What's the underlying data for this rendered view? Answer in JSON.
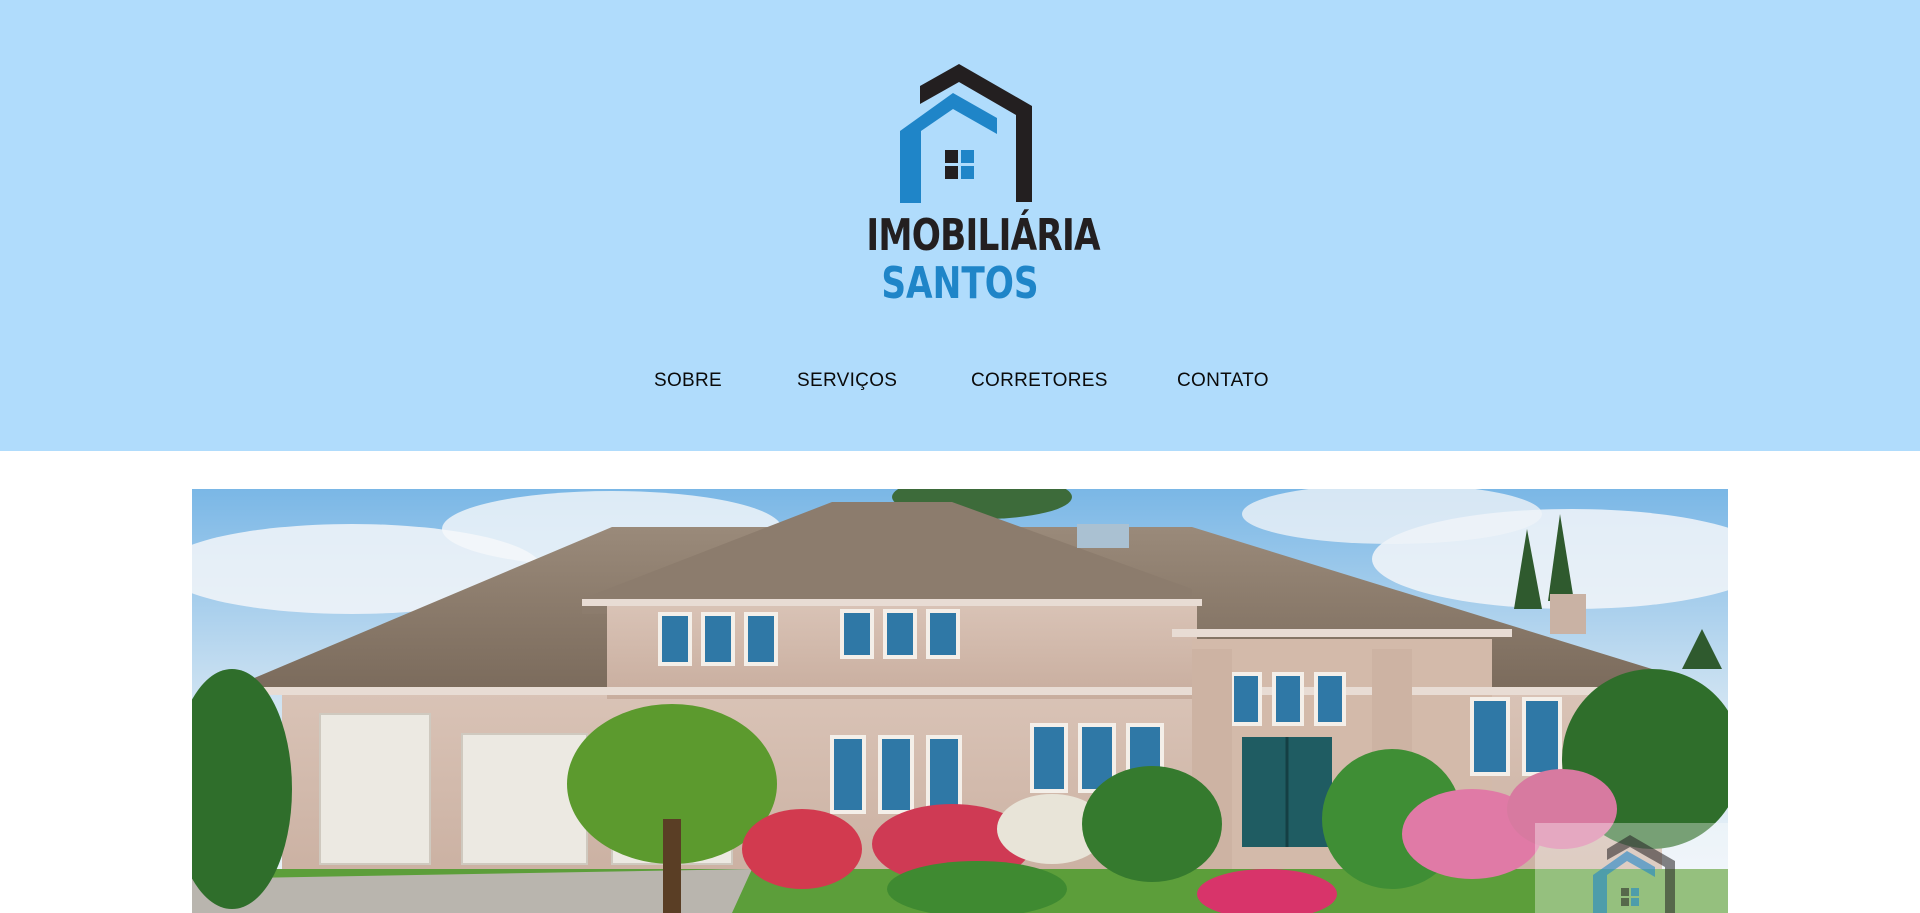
{
  "brand": {
    "name_line1": "IMOBILIÁRIA",
    "name_line2": "SANTOS",
    "logo_icon": "house-logo-icon",
    "colors": {
      "dark": "#231f20",
      "blue": "#1f85c8",
      "header_bg": "#b0dcfc"
    }
  },
  "nav": {
    "items": [
      {
        "label": "SOBRE"
      },
      {
        "label": "SERVIÇOS"
      },
      {
        "label": "CORRETORES"
      },
      {
        "label": "CONTATO"
      }
    ]
  },
  "hero": {
    "image": "house-photo"
  }
}
